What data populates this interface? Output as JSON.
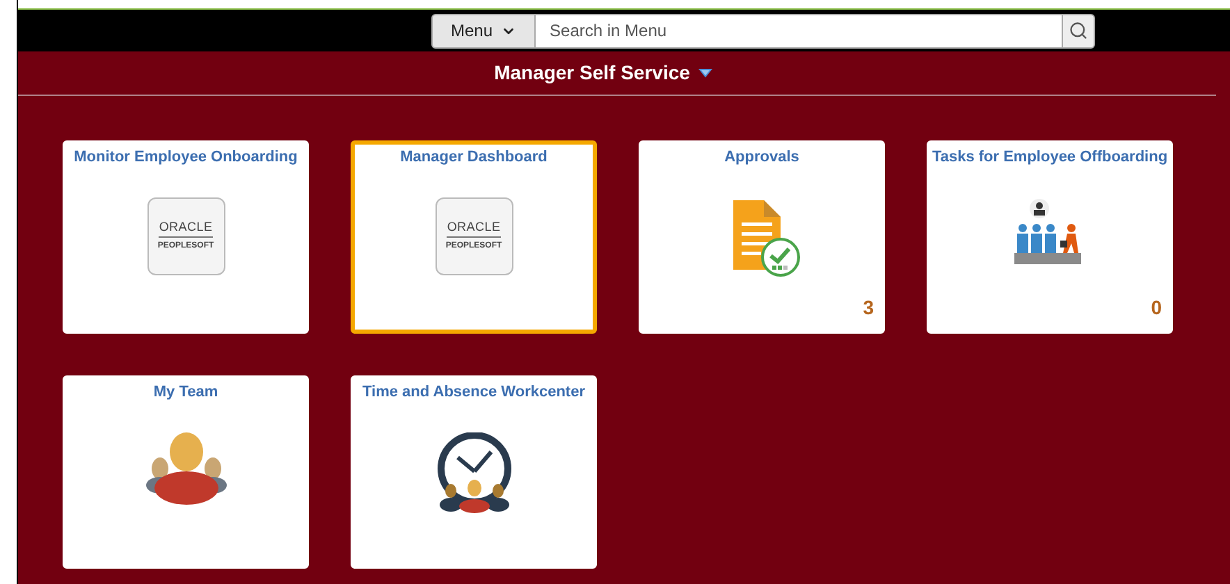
{
  "header": {
    "menu_button": "Menu",
    "search": {
      "placeholder": "Search in Menu"
    }
  },
  "banner": {
    "title": "Manager Self Service"
  },
  "tiles": [
    {
      "title": "Monitor Employee Onboarding",
      "kind": "logo",
      "logo_text": [
        "ORACLE",
        "PEOPLESOFT"
      ],
      "selected": false
    },
    {
      "title": "Manager Dashboard",
      "kind": "logo",
      "logo_text": [
        "ORACLE",
        "PEOPLESOFT"
      ],
      "selected": true
    },
    {
      "title": "Approvals",
      "kind": "approvals",
      "count": "3",
      "selected": false
    },
    {
      "title": "Tasks for Employee Offboarding",
      "kind": "offboarding",
      "count": "0",
      "selected": false
    },
    {
      "title": "My Team",
      "kind": "team",
      "selected": false
    },
    {
      "title": "Time and Absence Workcenter",
      "kind": "clock",
      "selected": false
    }
  ]
}
